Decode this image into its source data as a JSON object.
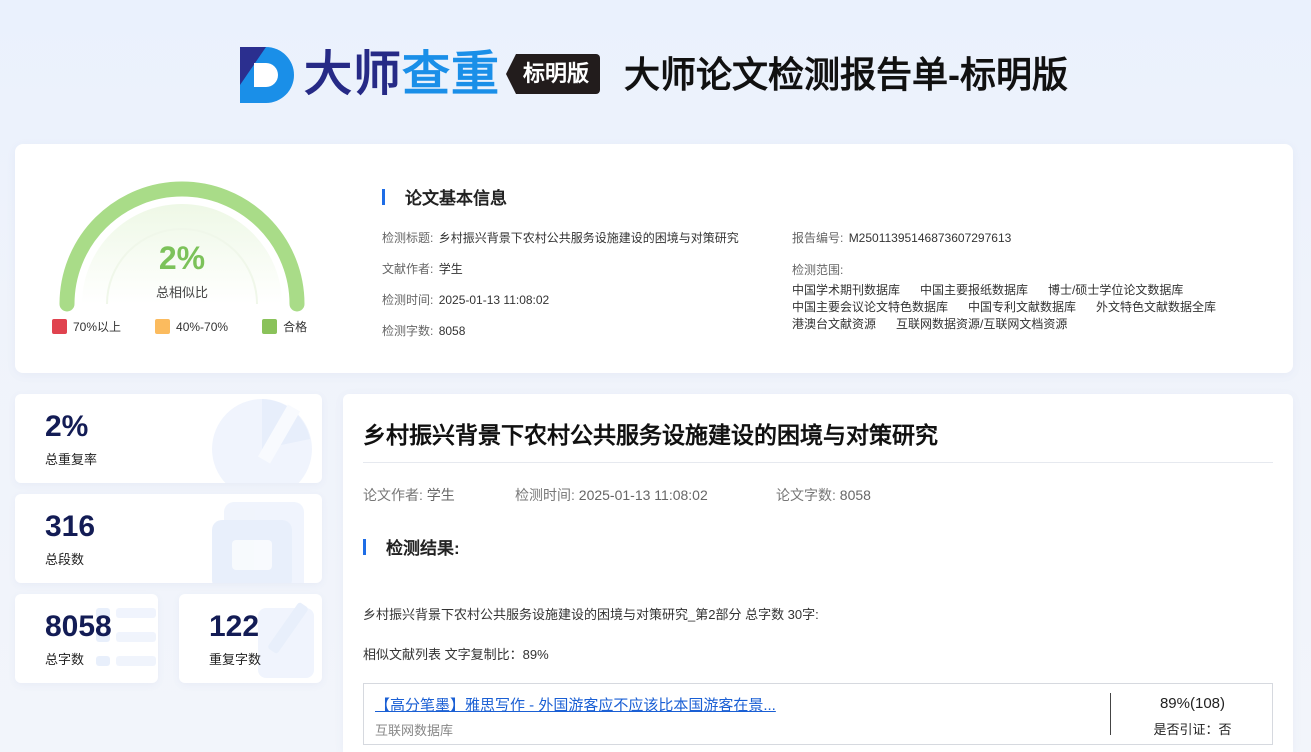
{
  "header": {
    "logo_dark": "大师",
    "logo_blue": "查重",
    "edition_badge": "标明版",
    "report_title": "大师论文检测报告单-标明版"
  },
  "gauge": {
    "value": "2%",
    "label": "总相似比",
    "level": 0.02
  },
  "legend": [
    {
      "label": "70%以上",
      "color": "#e0434f"
    },
    {
      "label": "40%-70%",
      "color": "#fbbb5e"
    },
    {
      "label": "合格",
      "color": "#8ac25a"
    }
  ],
  "basic_info": {
    "heading": "论文基本信息",
    "title_label": "检测标题:",
    "title_value": "乡村振兴背景下农村公共服务设施建设的困境与对策研究",
    "author_label": "文献作者:",
    "author_value": "学生",
    "time_label": "检测时间:",
    "time_value": "2025-01-13 11:08:02",
    "words_label": "检测字数:",
    "words_value": "8058",
    "report_no_label": "报告编号:",
    "report_no_value": "M250113951468736072976​13",
    "scope_label": "检测范围:",
    "scope_rows": [
      [
        "中国学术期刊数据库",
        "中国主要报纸数据库",
        "博士/硕士学位论文数据库"
      ],
      [
        "中国主要会议论文特色数据库",
        "中国专利文献数据库",
        "外文特色文献数据全库"
      ],
      [
        "港澳台文献资源",
        "互联网数据资源/互联网文档资源"
      ]
    ]
  },
  "stats": {
    "repeat_rate": {
      "value": "2%",
      "label": "总重复率"
    },
    "paragraphs": {
      "value": "316",
      "label": "总段数"
    },
    "total_words": {
      "value": "8058",
      "label": "总字数"
    },
    "repeat_words": {
      "value": "122",
      "label": "重复字数"
    }
  },
  "main": {
    "doc_title": "乡村振兴背景下农村公共服务设施建设的困境与对策研究",
    "author_label": "论文作者:",
    "author_value": "学生",
    "time_label": "检测时间:",
    "time_value": "2025-01-13 11:08:02",
    "words_label": "论文字数:",
    "words_value": "8058",
    "result_heading": "检测结果:",
    "part_line": "乡村振兴背景下农村公共服务设施建设的困境与对策研究_第2部分 总字数 30字:",
    "similar_line": "相似文献列表 文字复制比：89%",
    "results": [
      {
        "title": "【高分笔墨】雅思写作 - 外国游客应不应该比本国游客在景...",
        "source": "互联网数据库",
        "percent": "89%(108)",
        "cite": "是否引证：否"
      }
    ]
  },
  "colors": {
    "accent": "#1e6de6",
    "gauge_green": "#7cc25a",
    "stat_number": "#131c55"
  }
}
